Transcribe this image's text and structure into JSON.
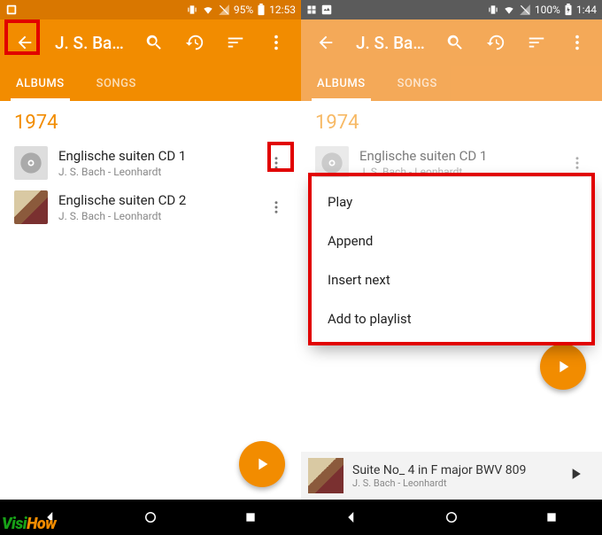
{
  "left": {
    "status": {
      "battery": "95%",
      "time": "12:53"
    },
    "appbar": {
      "title": "J. S. Bach -..."
    },
    "tabs": {
      "albums": "ALBUMS",
      "songs": "SONGS"
    },
    "year": "1974",
    "rows": [
      {
        "title": "Englische suiten CD 1",
        "sub": "J. S. Bach - Leonhardt"
      },
      {
        "title": "Englische suiten CD 2",
        "sub": "J. S. Bach - Leonhardt"
      }
    ]
  },
  "right": {
    "status": {
      "battery": "100%",
      "time": "1:44"
    },
    "appbar": {
      "title": "J. S. Bach -..."
    },
    "tabs": {
      "albums": "ALBUMS",
      "songs": "SONGS"
    },
    "year": "1974",
    "rows": [
      {
        "title": "Englische suiten CD 1",
        "sub": "J. S. Bach - Leonhardt"
      }
    ],
    "menu": {
      "play": "Play",
      "append": "Append",
      "insert": "Insert next",
      "addpl": "Add to playlist"
    },
    "fab_pos": "upper",
    "nowplaying": {
      "title": "Suite No_ 4 in F major BWV 809",
      "sub": "J. S. Bach - Leonhardt"
    }
  },
  "watermark": {
    "a": "Visi",
    "b": "How"
  }
}
